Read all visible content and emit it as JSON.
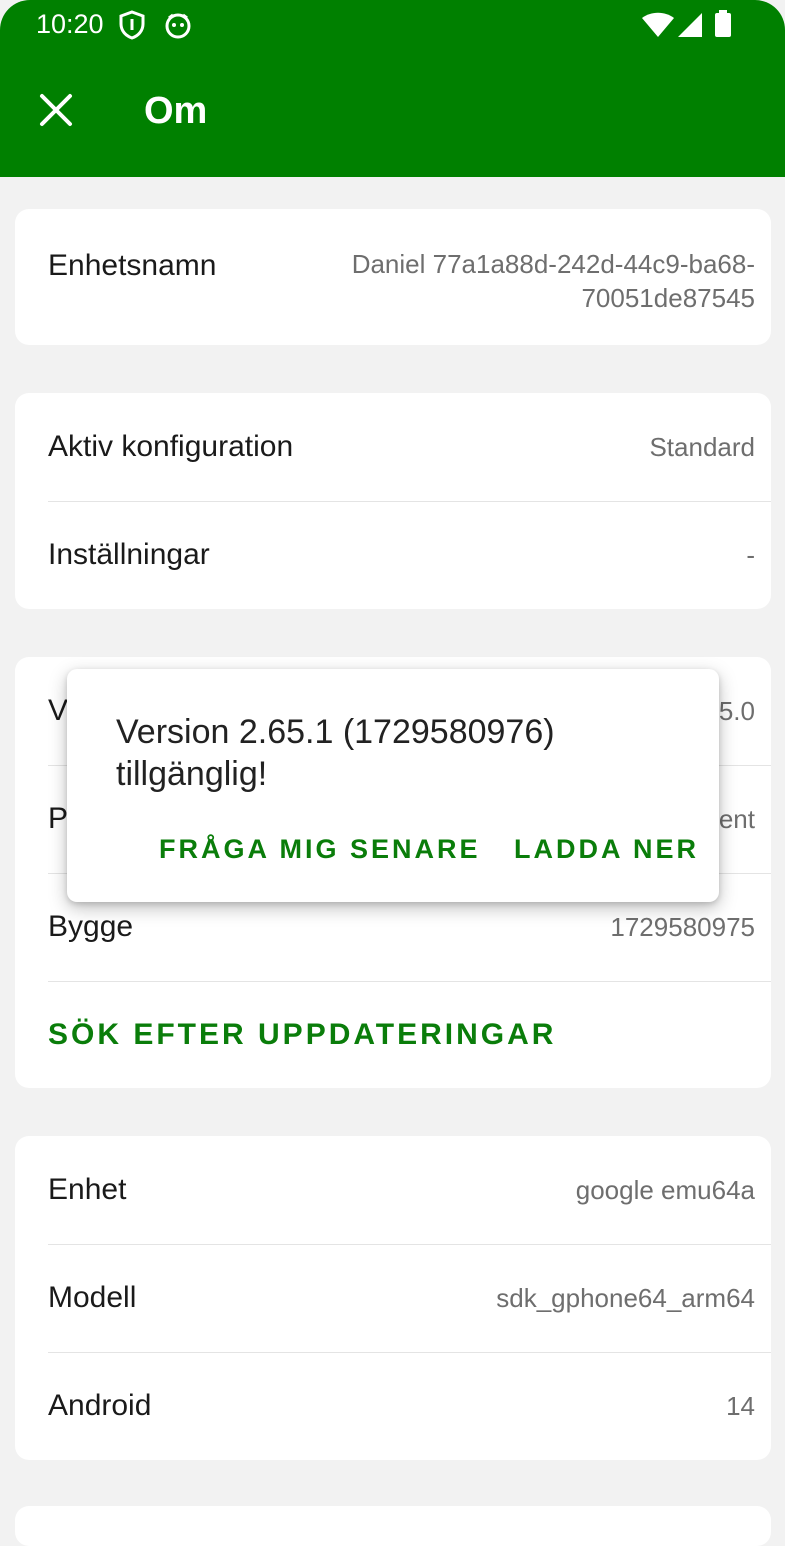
{
  "status_bar": {
    "time": "10:20",
    "icons": [
      "shield-icon",
      "app-face-icon",
      "wifi-icon",
      "signal-icon",
      "battery-icon"
    ]
  },
  "app_bar": {
    "close_icon": "close-icon",
    "title": "Om"
  },
  "colors": {
    "primary": "#008000",
    "accent_text": "#0a7d0a",
    "background": "#f2f2f2",
    "secondary_text": "#6e6e6e"
  },
  "device_card": {
    "label": "Enhetsnamn",
    "value": "Daniel 77a1a88d-242d-44c9-ba68-70051de87545"
  },
  "config_card": {
    "rows": [
      {
        "label": "Aktiv konfiguration",
        "value": "Standard"
      },
      {
        "label": "Inställningar",
        "value": "-"
      }
    ]
  },
  "version_card": {
    "rows": [
      {
        "label": "V",
        "value": "5.0"
      },
      {
        "label": "P",
        "value": "ent"
      },
      {
        "label": "Bygge",
        "value": "1729580975"
      }
    ],
    "action": "SÖK EFTER UPPDATERINGAR"
  },
  "hardware_card": {
    "rows": [
      {
        "label": "Enhet",
        "value": "google emu64a"
      },
      {
        "label": "Modell",
        "value": "sdk_gphone64_arm64"
      },
      {
        "label": "Android",
        "value": "14"
      }
    ]
  },
  "dialog": {
    "message": "Version 2.65.1 (1729580976) tillgänglig!",
    "later_button": "FRÅGA MIG SENARE",
    "download_button": "LADDA NER"
  }
}
